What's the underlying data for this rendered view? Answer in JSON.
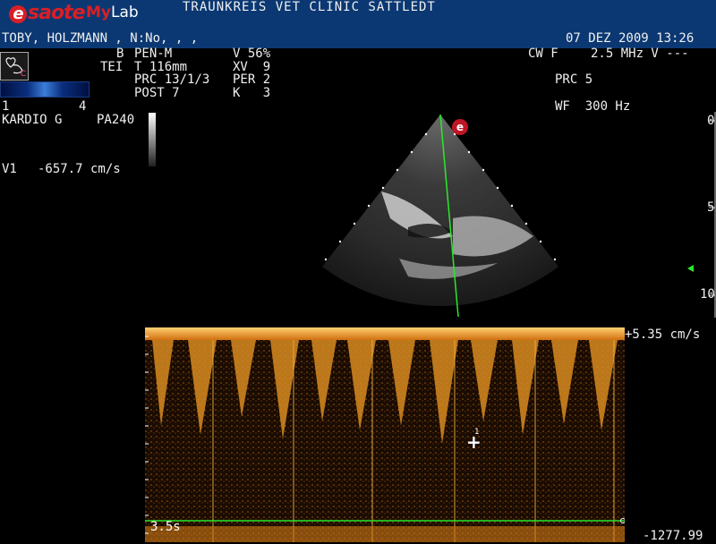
{
  "header": {
    "brand": "saote",
    "brand_e": "e",
    "model_prefix": "My",
    "model_suffix": "Lab",
    "clinic": "TRAUNKREIS VET CLINIC SATTLEDT",
    "patient": "TOBY, HOLZMANN , N:No, , ,",
    "datetime": "07 DEZ 2009 13:26"
  },
  "params_left": {
    "b": "B",
    "tei": "TEI",
    "pen": "PEN-M",
    "t": "T 116mm",
    "prc": "PRC 13/1/3",
    "post": "POST 7",
    "v": "V 56%",
    "xv": "XV  9",
    "per": "PER 2",
    "k": "K   3"
  },
  "params_right": {
    "cw": "CW F",
    "freq": "2.5 MHz V ---",
    "prc": "PRC 5",
    "wf": "WF  300 Hz"
  },
  "colormap": {
    "min": "1",
    "max": "4",
    "preset": "KARDIO G",
    "pa": "PA240"
  },
  "measurement": {
    "label": "V1",
    "value": "-657.7 cm/s"
  },
  "depth_scale": {
    "top": "0",
    "mid": "5",
    "bottom": "10"
  },
  "doppler": {
    "scale_top": "+5.35 cm/s",
    "scale_bottom": "-1277.99",
    "time": "3.5s",
    "cursor_label": "1"
  },
  "ecg_marker": "e",
  "probe_badge": "C",
  "colors": {
    "header_bg": "#0b3872",
    "brand_red": "#d81f26",
    "doppler_orange": "#f0a020",
    "baseline_green": "#2be82b"
  }
}
